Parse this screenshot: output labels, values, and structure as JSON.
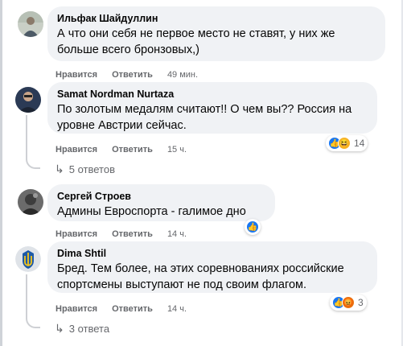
{
  "actions": {
    "like_label": "Нравится",
    "reply_label": "Ответить"
  },
  "colors": {
    "bubble": "#f0f2f5",
    "meta": "#65676b",
    "like": "#1877f2",
    "angry": "#e9710f",
    "haha": "#f7b125"
  },
  "comments": [
    {
      "author": "Ильфак Шайдуллин",
      "text_lines": [
        "А что они себя не первое место не ставят, у них же",
        "больше всего бронзовых,)"
      ],
      "time": "49 мин."
    },
    {
      "author": "Samat Nordman Nurtaza",
      "text_lines": [
        "По золотым медалям считают!! О чем вы?? Россия на",
        "уровне Австрии сейчас."
      ],
      "time": "15 ч.",
      "reactions": {
        "icons": [
          "like-icon",
          "haha-icon"
        ],
        "count": "14"
      },
      "replies": "5 ответов"
    },
    {
      "author": "Сергей Строев",
      "text_lines": [
        "Админы Евроспорта - галимое дно"
      ],
      "time": "14 ч.",
      "reactions": {
        "icons": [
          "like-icon"
        ],
        "count": ""
      }
    },
    {
      "author": "Dima Shtil",
      "text_lines": [
        "Бред. Тем более, на этих соревнованиях российские",
        "спортсмены выступают не под своим флагом."
      ],
      "time": "14 ч.",
      "reactions": {
        "icons": [
          "like-icon",
          "angry-icon"
        ],
        "count": "3"
      },
      "replies": "3 ответа"
    }
  ]
}
